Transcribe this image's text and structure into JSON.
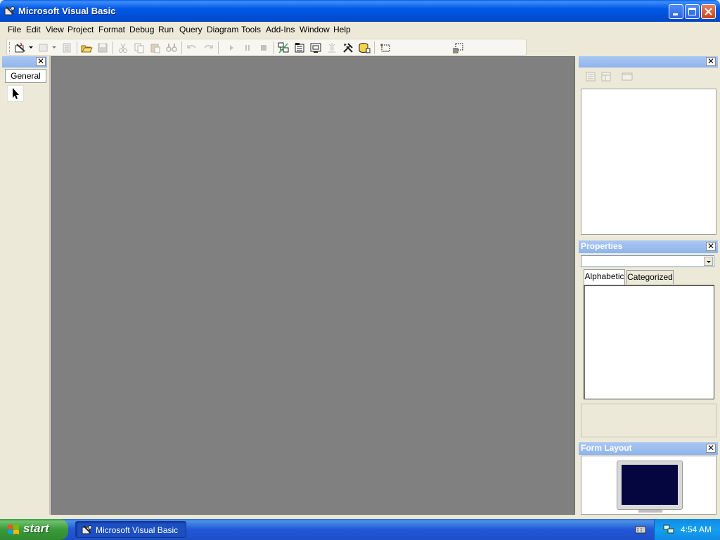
{
  "window": {
    "title": "Microsoft Visual Basic"
  },
  "menu": {
    "items": [
      {
        "label": "File"
      },
      {
        "label": "Edit"
      },
      {
        "label": "View"
      },
      {
        "label": "Project"
      },
      {
        "label": "Format"
      },
      {
        "label": "Debug"
      },
      {
        "label": "Run"
      },
      {
        "label": "Query"
      },
      {
        "label": "Diagram"
      },
      {
        "label": "Tools"
      },
      {
        "label": "Add-Ins"
      },
      {
        "label": "Window"
      },
      {
        "label": "Help"
      }
    ]
  },
  "toolbar": {
    "buttons": [
      {
        "icon": "add-project-icon",
        "enabled": true
      },
      {
        "icon": "add-form-icon",
        "enabled": false
      },
      {
        "icon": "menu-editor-icon",
        "enabled": false
      },
      {
        "icon": "open-folder-icon",
        "enabled": true
      },
      {
        "icon": "save-icon",
        "enabled": false
      },
      {
        "icon": "cut-icon",
        "enabled": false
      },
      {
        "icon": "copy-icon",
        "enabled": false
      },
      {
        "icon": "paste-icon",
        "enabled": false
      },
      {
        "icon": "find-icon",
        "enabled": false
      },
      {
        "icon": "undo-icon",
        "enabled": false
      },
      {
        "icon": "redo-icon",
        "enabled": false
      },
      {
        "icon": "start-icon",
        "enabled": false
      },
      {
        "icon": "break-icon",
        "enabled": false
      },
      {
        "icon": "end-icon",
        "enabled": false
      },
      {
        "icon": "project-explorer-icon",
        "enabled": true
      },
      {
        "icon": "properties-window-icon",
        "enabled": true
      },
      {
        "icon": "form-layout-icon",
        "enabled": true
      },
      {
        "icon": "object-browser-icon",
        "enabled": false
      },
      {
        "icon": "toolbox-icon",
        "enabled": true
      },
      {
        "icon": "data-view-icon",
        "enabled": true
      },
      {
        "icon": "component-manager-icon",
        "enabled": true
      },
      {
        "icon": "position-size-icon",
        "enabled": true
      }
    ]
  },
  "toolbox": {
    "tab_label": "General",
    "tools": [
      {
        "icon": "pointer-icon"
      }
    ]
  },
  "project_explorer": {
    "tools": [
      {
        "icon": "view-code-icon",
        "enabled": false
      },
      {
        "icon": "view-object-icon",
        "enabled": false
      },
      {
        "icon": "toggle-folders-icon",
        "enabled": false
      }
    ]
  },
  "properties": {
    "title": "Properties",
    "object_selector_value": "",
    "tabs": [
      {
        "label": "Alphabetic",
        "active": true
      },
      {
        "label": "Categorized",
        "active": false
      }
    ]
  },
  "form_layout": {
    "title": "Form Layout"
  },
  "taskbar": {
    "start_label": "start",
    "task_label": "Microsoft Visual Basic",
    "clock": "4:54 AM"
  },
  "colors": {
    "title_bar": "#0054e3",
    "mdi_background": "#808080",
    "panel_header": "#9ebdf0",
    "taskbar": "#245edb",
    "start_button": "#3c9b3c",
    "form_layout_screen": "#050540"
  }
}
